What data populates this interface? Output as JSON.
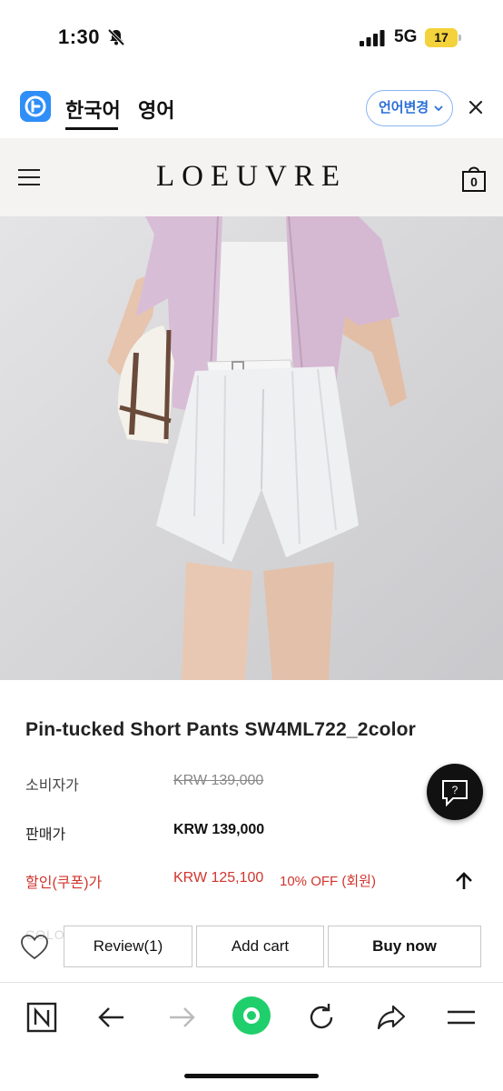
{
  "status_bar": {
    "time": "1:30",
    "network": "5G",
    "battery": "17"
  },
  "translate_bar": {
    "tabs": [
      "한국어",
      "영어"
    ],
    "language_button": "언어변경"
  },
  "site_header": {
    "brand": "LOEUVRE",
    "cart_count": "0"
  },
  "product": {
    "title": "Pin-tucked Short Pants SW4ML722_2color",
    "consumer_price_label": "소비자가",
    "consumer_price": "KRW 139,000",
    "sale_price_label": "판매가",
    "sale_price": "KRW 139,000",
    "coupon_price_label": "할인(쿠폰)가",
    "coupon_price": "KRW 125,100",
    "coupon_discount": "10% OFF (회원)"
  },
  "chat_button": {
    "glyph": "?"
  },
  "action_bar": {
    "ghost_label": "COLOR",
    "review_label": "Review(1)",
    "add_cart_label": "Add cart",
    "buy_now_label": "Buy now"
  },
  "icons": {
    "accent": "#2f8ef7",
    "sale_red": "#d0352e",
    "browser_green": "#1fcf6b"
  }
}
